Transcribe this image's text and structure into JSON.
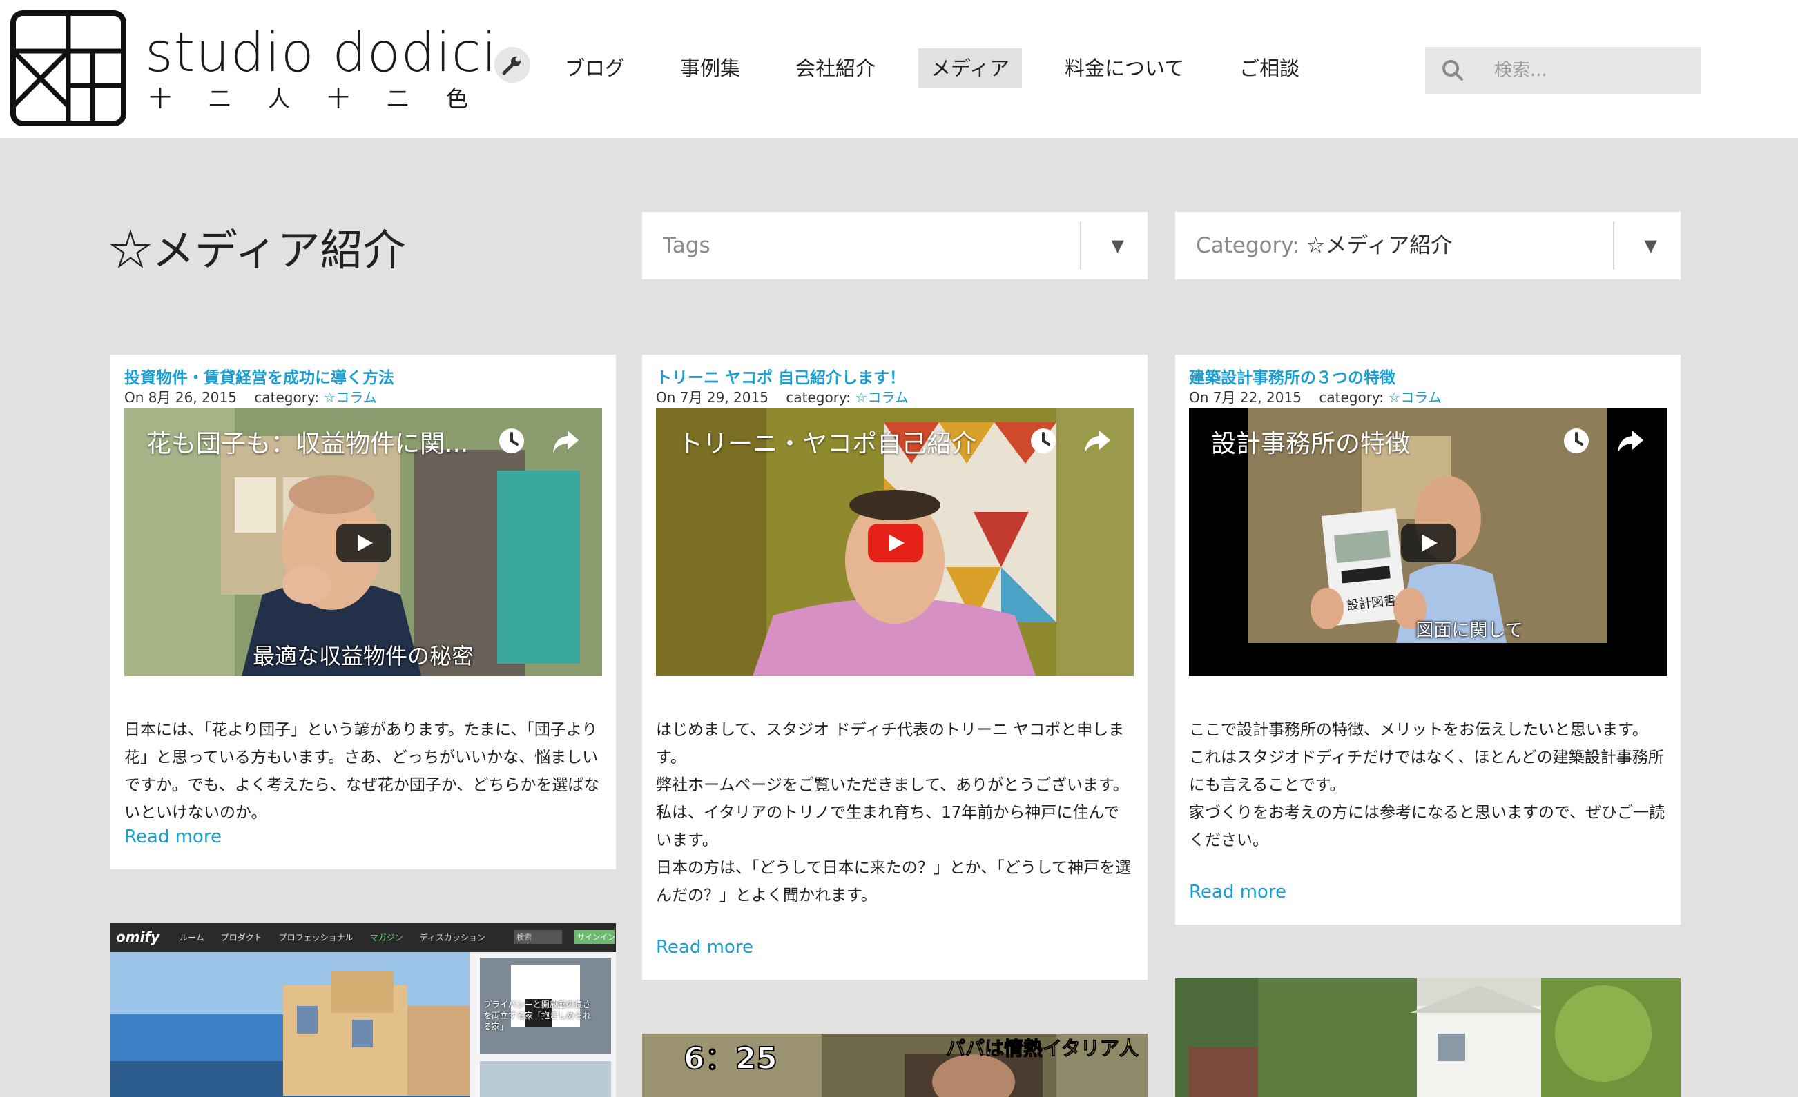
{
  "header": {
    "brand": "studio dodici",
    "brand_sub": "十二人十二色",
    "nav": [
      {
        "label": "ブログ",
        "active": false
      },
      {
        "label": "事例集",
        "active": false
      },
      {
        "label": "会社紹介",
        "active": false
      },
      {
        "label": "メディア",
        "active": true
      },
      {
        "label": "料金について",
        "active": false
      },
      {
        "label": "ご相談",
        "active": false
      }
    ],
    "search_placeholder": "検索..."
  },
  "page": {
    "title": "☆メディア紹介",
    "tags_label": "Tags",
    "category_prefix": "Category: ",
    "category_value": "☆メディア紹介"
  },
  "posts": [
    {
      "title": "投資物件・賃貸経営を成功に導く方法",
      "date": "On 8月 26, 2015",
      "category_label": "category: ",
      "category": "☆コラム",
      "video_title": "花も団子も：収益物件に関...",
      "video_caption": "最適な収益物件の秘密",
      "body": [
        "日本には、「花より団子」という諺があります。たまに、「団子より花」と思っている方もいます。さあ、どっちがいいかな、悩ましいですか。でも、よく考えたら、なぜ花か団子か、どちらかを選ばないといけないのか。"
      ],
      "read_more": "Read more"
    },
    {
      "title": "トリーニ ヤコポ 自己紹介します！",
      "date": "On 7月 29, 2015",
      "category_label": "category: ",
      "category": "☆コラム",
      "video_title": "トリーニ・ヤコポ自己紹介",
      "video_caption": "",
      "body": [
        "はじめまして、スタジオ ドディチ代表のトリーニ ヤコポと申します。",
        "弊社ホームページをご覧いただきまして、ありがとうございます。",
        "私は、イタリアのトリノで生まれ育ち、17年前から神戸に住んでいます。",
        "日本の方は、「どうして日本に来たの？」とか、「どうして神戸を選んだの？」とよく聞かれます。"
      ],
      "read_more": "Read more"
    },
    {
      "title": "建築設計事務所の３つの特徴",
      "date": "On 7月 22, 2015",
      "category_label": "category: ",
      "category": "☆コラム",
      "video_title": "設計事務所の特徴",
      "video_caption": "図面に関して",
      "book_text": "設計図書",
      "body": [
        "ここで設計事務所の特徴、メリットをお伝えしたいと思います。",
        "これはスタジオドディチだけではなく、ほとんどの建築設計事務所にも言えることです。",
        "家づくりをお考えの方には参考になると思いますので、ぜひご一読ください。"
      ],
      "read_more": "Read more"
    }
  ],
  "thumbs": {
    "homify_nav": [
      "ルーム",
      "プロダクト",
      "プロフェッショナル",
      "マガジン",
      "ディスカッション"
    ],
    "homify_search": "検索",
    "homify_signin": "サインイン",
    "homify_side_caption": "プライバシーと開放感の良さを両立する家「抱きしめられる家」",
    "tv_time": "6：25",
    "tv_caption": "パパは情熱イタリア人"
  },
  "colors": {
    "accent": "#1b9ed1",
    "page_bg": "#e1e1e1",
    "youtube_red": "#e62117"
  }
}
